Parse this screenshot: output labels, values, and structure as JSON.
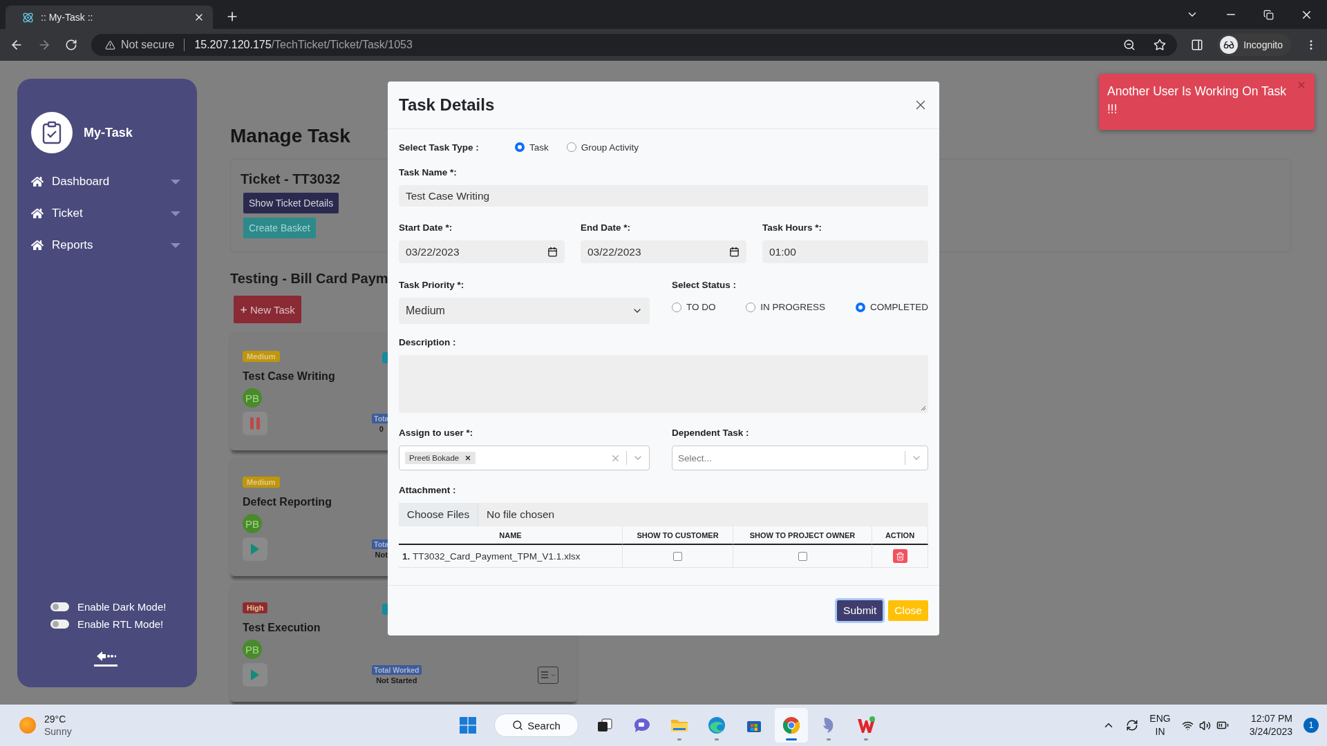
{
  "browser": {
    "tab_title": ":: My-Task ::",
    "security": "Not secure",
    "url_host": "15.207.120.175",
    "url_path": "/TechTicket/Ticket/Task/1053",
    "profile": "Incognito"
  },
  "sidebar": {
    "brand": "My-Task",
    "items": [
      {
        "label": "Dashboard"
      },
      {
        "label": "Ticket"
      },
      {
        "label": "Reports"
      }
    ],
    "toggles": [
      {
        "label": "Enable Dark Mode!",
        "on": false
      },
      {
        "label": "Enable RTL Mode!",
        "on": false
      }
    ]
  },
  "main": {
    "title": "Manage Task",
    "ticket": {
      "title": "Ticket - TT3032",
      "buttons": [
        {
          "label": "Show Ticket Details",
          "kind": "primary"
        },
        {
          "label": "Create Basket",
          "kind": "info"
        }
      ]
    },
    "section_title": "Testing - Bill Card Paym",
    "new_task_button": "New Task",
    "tasks": [
      {
        "priority": "Medium",
        "color": "#bf960c",
        "title": "Test Case Writing",
        "avatar": "PB",
        "running": true,
        "tag": true,
        "worked_label": "Tota",
        "worked_value": "0",
        "menu": false
      },
      {
        "priority": "Medium",
        "color": "#bf960c",
        "title": "Defect Reporting",
        "avatar": "PB",
        "running": false,
        "tag": false,
        "worked_label": "Tota",
        "worked_value": "Not",
        "menu": false
      },
      {
        "priority": "High",
        "color": "#8e2a34",
        "title": "Test Execution",
        "avatar": "PB",
        "running": false,
        "tag": true,
        "worked_label": "Total Worked",
        "worked_value": "Not Started",
        "menu": true
      }
    ]
  },
  "modal": {
    "title": "Task Details",
    "task_type": {
      "label": "Select Task Type :",
      "options": [
        {
          "label": "Task",
          "selected": true
        },
        {
          "label": "Group Activity",
          "selected": false
        }
      ]
    },
    "task_name": {
      "label": "Task Name *:",
      "value": "Test Case Writing"
    },
    "start_date": {
      "label": "Start Date *:",
      "value": "03/22/2023"
    },
    "end_date": {
      "label": "End Date *:",
      "value": "03/22/2023"
    },
    "task_hours": {
      "label": "Task Hours *:",
      "value": "01:00"
    },
    "priority": {
      "label": "Task Priority *:",
      "value": "Medium"
    },
    "status": {
      "label": "Select Status :",
      "options": [
        {
          "label": "TO DO",
          "selected": false
        },
        {
          "label": "IN PROGRESS",
          "selected": false
        },
        {
          "label": "COMPLETED",
          "selected": true
        }
      ]
    },
    "description": {
      "label": "Description :"
    },
    "assign": {
      "label": "Assign to user *:",
      "tags": [
        "Preeti Bokade"
      ]
    },
    "dependent": {
      "label": "Dependent Task :",
      "placeholder": "Select..."
    },
    "attachment": {
      "label": "Attachment :",
      "button": "Choose Files",
      "status": "No file chosen",
      "columns": [
        "NAME",
        "SHOW TO CUSTOMER",
        "SHOW TO PROJECT OWNER",
        "ACTION"
      ],
      "rows": [
        {
          "index": "1.",
          "name": "TT3032_Card_Payment_TPM_V1.1.xlsx",
          "show_to_customer": false,
          "show_to_project_owner": false
        }
      ]
    },
    "buttons": [
      {
        "label": "Submit",
        "kind": "primary"
      },
      {
        "label": "Close",
        "kind": "warning"
      }
    ]
  },
  "toast": {
    "message": "Another User Is Working On Task !!!"
  },
  "taskbar": {
    "temperature": "29°C",
    "condition": "Sunny",
    "search": "Search",
    "apps": [
      {
        "kind": "taskview",
        "running": false,
        "selected": false
      },
      {
        "kind": "chat",
        "running": false,
        "selected": false
      },
      {
        "kind": "folder",
        "running": true,
        "selected": false
      },
      {
        "kind": "edge",
        "running": true,
        "selected": false
      },
      {
        "kind": "store",
        "running": false,
        "selected": false
      },
      {
        "kind": "chrome",
        "running": true,
        "selected": true
      },
      {
        "kind": "dolphin",
        "running": true,
        "selected": false
      },
      {
        "kind": "office",
        "running": true,
        "selected": false
      }
    ],
    "language": "ENG",
    "region": "IN",
    "time": "12:07 PM",
    "date": "3/24/2023",
    "notifications": "1"
  }
}
